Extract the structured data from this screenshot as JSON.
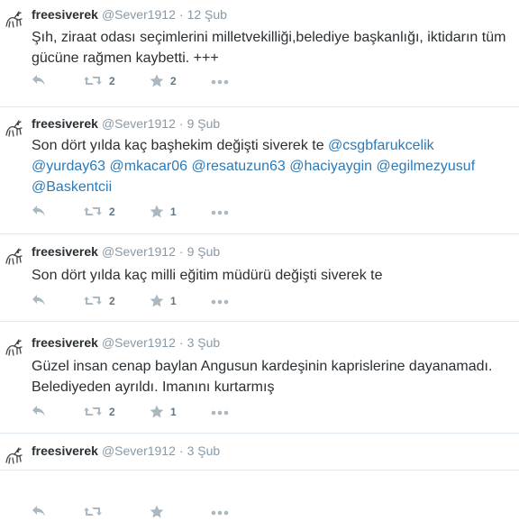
{
  "tweets": [
    {
      "name": "freesiverek",
      "handle": "@Sever1912",
      "sep": "·",
      "time": "12 Şub",
      "text_lines": [
        [
          {
            "t": "Şıh, ziraat odası seçimlerini milletvekilliği,belediye başkanlığı, iktidarın tüm"
          }
        ],
        [
          {
            "t": "gücüne rağmen kaybetti. +++"
          }
        ]
      ],
      "retweets": "2",
      "favorites": "2"
    },
    {
      "name": "freesiverek",
      "handle": "@Sever1912",
      "sep": "·",
      "time": "9 Şub",
      "text_lines": [
        [
          {
            "t": "Son dört yılda kaç başhekim değişti siverek te "
          },
          {
            "t": "@csgbfarukcelik",
            "m": true
          }
        ],
        [
          {
            "t": "@yurday63",
            "m": true
          },
          {
            "t": " "
          },
          {
            "t": "@mkacar06",
            "m": true
          },
          {
            "t": " "
          },
          {
            "t": "@resatuzun63",
            "m": true
          },
          {
            "t": " "
          },
          {
            "t": "@haciyaygin",
            "m": true
          },
          {
            "t": " "
          },
          {
            "t": "@egilmezyusuf",
            "m": true
          }
        ],
        [
          {
            "t": "@Baskentcii",
            "m": true
          }
        ]
      ],
      "retweets": "2",
      "favorites": "1"
    },
    {
      "name": "freesiverek",
      "handle": "@Sever1912",
      "sep": "·",
      "time": "9 Şub",
      "text_lines": [
        [
          {
            "t": "Son dört yılda kaç milli eğitim müdürü değişti siverek te"
          }
        ]
      ],
      "retweets": "2",
      "favorites": "1"
    },
    {
      "name": "freesiverek",
      "handle": "@Sever1912",
      "sep": "·",
      "time": "3 Şub",
      "text_lines": [
        [
          {
            "t": "Güzel insan cenap baylan Angusun kardeşinin kaprislerine dayanamadı."
          }
        ],
        [
          {
            "t": "Belediyeden ayrıldı. Imanını kurtarmış"
          }
        ]
      ],
      "retweets": "2",
      "favorites": "1"
    },
    {
      "name": "freesiverek",
      "handle": "@Sever1912",
      "sep": "·",
      "time": "3 Şub",
      "text_lines": [],
      "retweets": "",
      "favorites": ""
    }
  ],
  "colors": {
    "text": "#292f33",
    "muted": "#8899a6",
    "mention": "#2b7bb9",
    "action_icon": "#aab8c2",
    "divider": "#e1e8ed"
  },
  "icons": {
    "avatar": "goat-drawing-avatar",
    "reply": "reply-icon",
    "retweet": "retweet-icon",
    "favorite": "star-icon",
    "more": "more-dots-icon"
  }
}
